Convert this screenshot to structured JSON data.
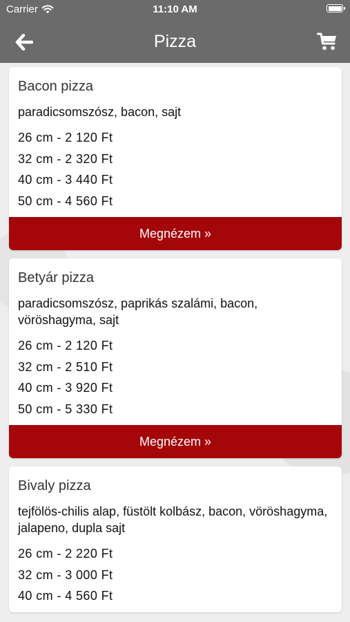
{
  "status_bar": {
    "carrier": "Carrier",
    "time": "11:10 AM"
  },
  "navbar": {
    "title": "Pizza",
    "back_icon": "arrow-left-icon",
    "cart_icon": "shopping-cart-icon"
  },
  "colors": {
    "header_bg": "#6b6b6b",
    "accent": "#a4060a"
  },
  "pizzas": [
    {
      "name": "Bacon pizza",
      "description": "paradicsomszósz, bacon, sajt",
      "prices": [
        "26 cm - 2 120 Ft",
        "32 cm - 2 320 Ft",
        "40 cm - 3 440 Ft",
        "50 cm - 4 560 Ft"
      ],
      "button": "Megnézem »"
    },
    {
      "name": "Betyár pizza",
      "description": "paradicsomszósz, paprikás szalámi, bacon, vöröshagyma, sajt",
      "prices": [
        "26 cm - 2 120 Ft",
        "32 cm - 2 510 Ft",
        "40 cm - 3 920 Ft",
        "50 cm - 5 330 Ft"
      ],
      "button": "Megnézem »"
    },
    {
      "name": "Bivaly pizza",
      "description": "tejfölös-chilis alap, füstölt kolbász, bacon, vöröshagyma, jalapeno, dupla sajt",
      "prices": [
        "26 cm - 2 220 Ft",
        "32 cm - 3 000 Ft",
        "40 cm - 4 560 Ft"
      ],
      "button": ""
    }
  ]
}
